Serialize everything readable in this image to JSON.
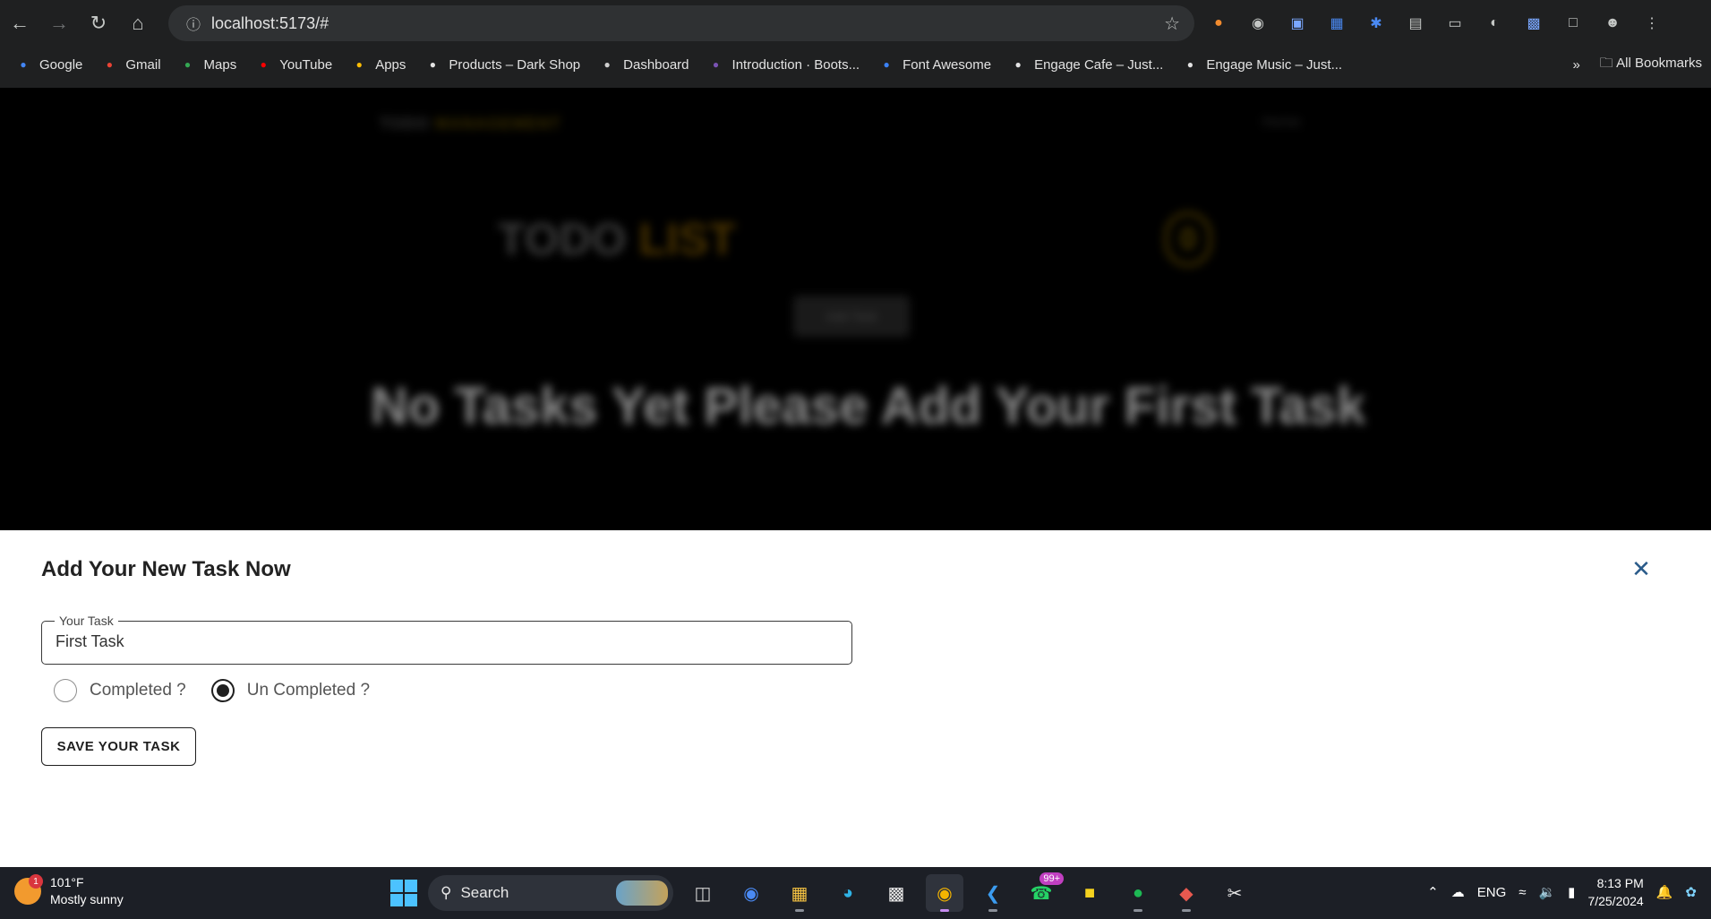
{
  "browser": {
    "url": "localhost:5173/#",
    "bookmarks": [
      {
        "label": "Google",
        "icon": "google-icon",
        "color": "#4285f4"
      },
      {
        "label": "Gmail",
        "icon": "gmail-icon",
        "color": "#ea4335"
      },
      {
        "label": "Maps",
        "icon": "maps-icon",
        "color": "#34a853"
      },
      {
        "label": "YouTube",
        "icon": "youtube-icon",
        "color": "#ff0000"
      },
      {
        "label": "Apps",
        "icon": "apps-grid-icon",
        "color": "#fbbc04"
      },
      {
        "label": "Products – Dark Shop",
        "icon": "page-icon",
        "color": "#e3e3e3"
      },
      {
        "label": "Dashboard",
        "icon": "dashboard-icon",
        "color": "#cfcfcf"
      },
      {
        "label": "Introduction · Boots...",
        "icon": "bootstrap-icon",
        "color": "#7952b3"
      },
      {
        "label": "Font Awesome",
        "icon": "flag-icon",
        "color": "#3b82f6"
      },
      {
        "label": "Engage Cafe – Just...",
        "icon": "page-icon",
        "color": "#e3e3e3"
      },
      {
        "label": "Engage Music – Just...",
        "icon": "page-icon",
        "color": "#e3e3e3"
      }
    ],
    "all_bookmarks": "All Bookmarks"
  },
  "app_background": {
    "brand": "TODO",
    "brand_accent": "MANAGEMENT",
    "nav_link": "Home",
    "title": "TODO",
    "title_accent": "LIST",
    "task_count": "0",
    "add_button": "Add Task",
    "empty_message": "No Tasks Yet Please Add Your First Task"
  },
  "drawer": {
    "title": "Add Your New Task Now",
    "field_label": "Your Task",
    "field_value": "First Task",
    "radio_completed": "Completed ?",
    "radio_uncompleted": "Un Completed ?",
    "selected_radio": "uncompleted",
    "save_label": "SAVE YOUR TASK"
  },
  "taskbar": {
    "weather_temp": "101°F",
    "weather_desc": "Mostly sunny",
    "weather_badge": "1",
    "search_label": "Search",
    "whatsapp_badge": "99+",
    "language": "ENG",
    "time": "8:13 PM",
    "date": "7/25/2024"
  },
  "colors": {
    "chrome_bg": "#1f2021",
    "accent_close": "#2a5b8a",
    "taskbar_bg": "#1c1f26"
  }
}
